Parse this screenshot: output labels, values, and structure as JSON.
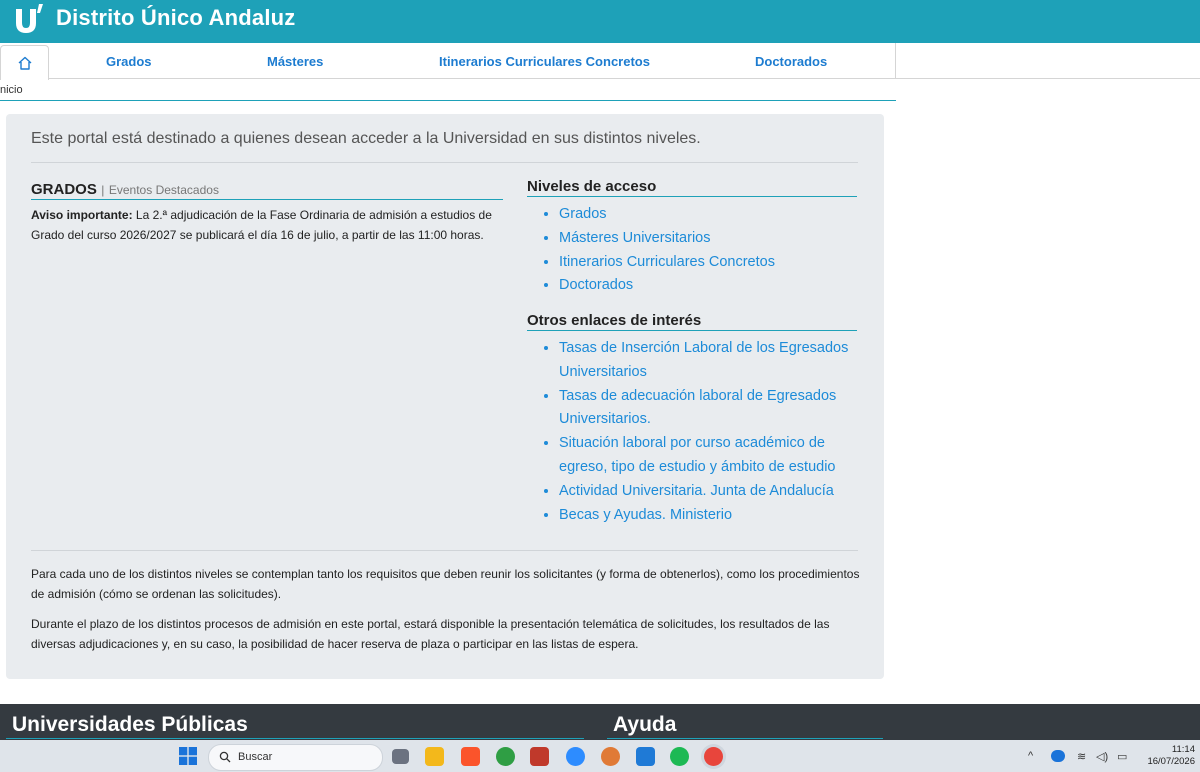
{
  "header": {
    "title": "Distrito Único Andaluz"
  },
  "nav": {
    "items": [
      {
        "label": "Grados"
      },
      {
        "label": "Másteres"
      },
      {
        "label": "Itinerarios Curriculares Concretos"
      },
      {
        "label": "Doctorados"
      }
    ]
  },
  "breadcrumb": "nicio",
  "main": {
    "lead": "Este portal está destinado a quienes desean acceder a la Universidad en sus distintos niveles.",
    "grados": {
      "title": "GRADOS",
      "separator": "|",
      "subtitle": "Eventos Destacados",
      "notice_label": "Aviso importante:",
      "notice_text": " La 2.ª adjudicación de la Fase Ordinaria de admisión a estudios de Grado del curso 2026/2027 se publicará el día 16 de julio, a partir de las 11:00 horas."
    },
    "niveles": {
      "title": "Niveles de acceso",
      "links": [
        "Grados",
        "Másteres Universitarios",
        "Itinerarios Curriculares Concretos",
        "Doctorados"
      ]
    },
    "otros": {
      "title": "Otros enlaces de interés",
      "links": [
        "Tasas de Inserción Laboral de los Egresados Universitarios",
        "Tasas de adecuación laboral de Egresados Universitarios.",
        "Situación laboral por curso académico de egreso, tipo de estudio y ámbito de estudio",
        "Actividad Universitaria. Junta de Andalucía",
        "Becas y Ayudas. Ministerio"
      ]
    },
    "para1": "Para cada uno de los distintos niveles se contemplan tanto los requisitos que deben reunir los solicitantes (y forma de obtenerlos), como los procedimientos de admisión (cómo se ordenan las solicitudes).",
    "para2": "Durante el plazo de los distintos procesos de admisión en este portal, estará disponible la presentación telemática de solicitudes, los resultados de las diversas adjudicaciones y, en su caso, la posibilidad de hacer reserva de plaza o participar en las listas de espera."
  },
  "footer": {
    "left_title": "Universidades Públicas",
    "right_title": "Ayuda"
  },
  "taskbar": {
    "search_placeholder": "Buscar",
    "time": "11:14",
    "date": "16/07/2026"
  },
  "colors": {
    "brand": "#1ea1b8",
    "link": "#1d8bd8",
    "footer": "#343a40"
  }
}
